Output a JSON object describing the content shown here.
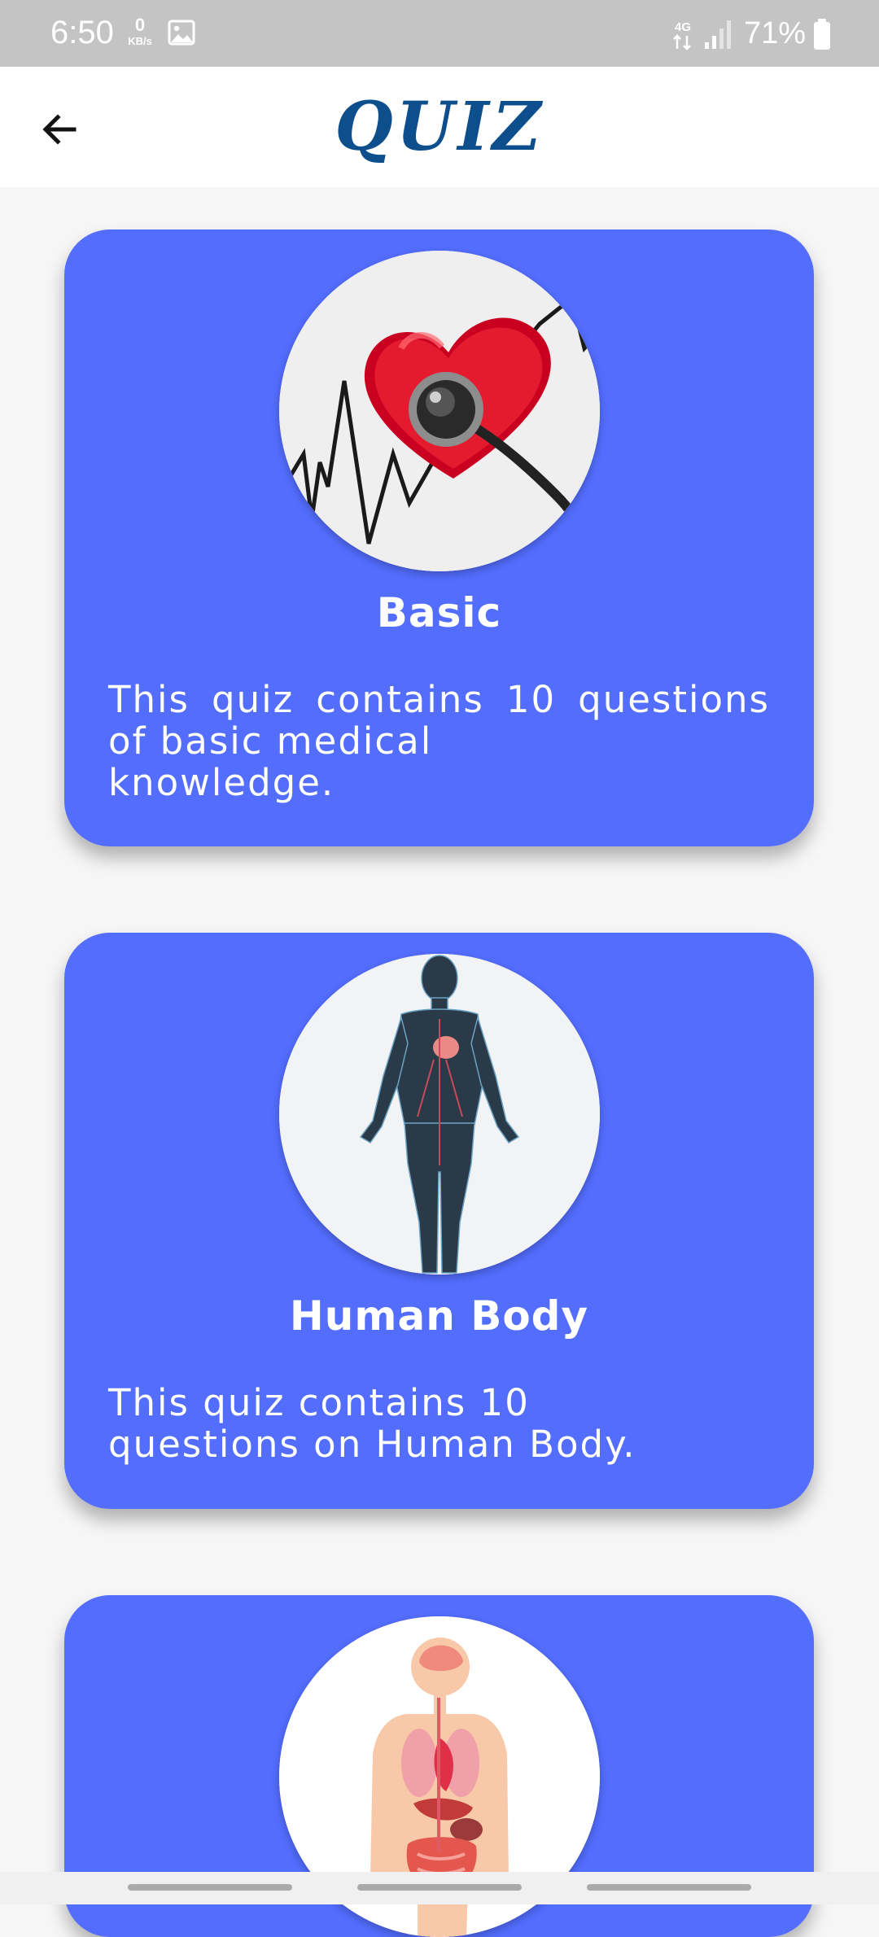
{
  "status_bar": {
    "time": "6:50",
    "net_speed_value": "0",
    "net_speed_unit": "KB/s",
    "network_type": "4G",
    "battery": "71%"
  },
  "header": {
    "title": "QUIZ",
    "back_icon": "arrow-left-icon"
  },
  "quizzes": [
    {
      "title": "Basic",
      "desc_line1": "This quiz contains 10 questions of basic medical",
      "desc_line2": "knowledge.",
      "image": "heart-stethoscope-image"
    },
    {
      "title": "Human Body",
      "desc_line1": "This quiz contains 10",
      "desc_line2": "questions on Human Body.",
      "image": "human-body-image"
    },
    {
      "title": "",
      "image": "internal-organs-image"
    }
  ],
  "colors": {
    "card": "#536dfe",
    "title": "#0d4f8c",
    "status_bar": "#c4c4c4",
    "background": "#f6f6f6"
  }
}
